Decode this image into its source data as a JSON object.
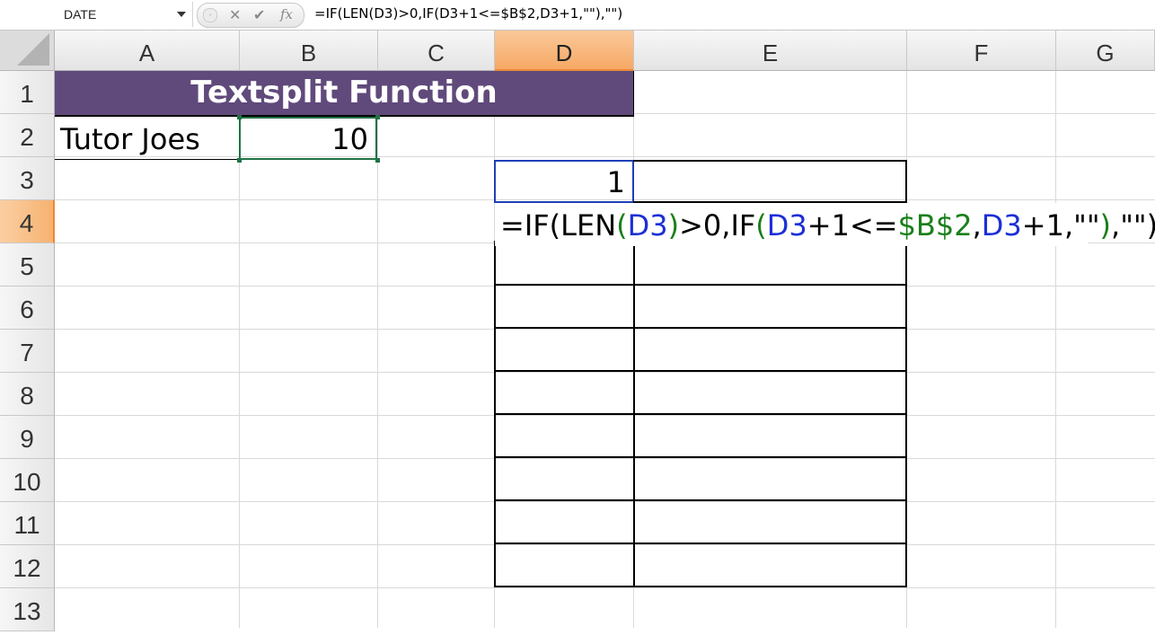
{
  "formula_bar": {
    "name_box": "DATE",
    "handle_glyph": "◦",
    "cancel_glyph": "✕",
    "enter_glyph": "✔",
    "fx_label": "fx",
    "formula": "=IF(LEN(D3)>0,IF(D3+1<=$B$2,D3+1,\"\"),\"\")"
  },
  "columns": [
    {
      "label": "A"
    },
    {
      "label": "B"
    },
    {
      "label": "C"
    },
    {
      "label": "D",
      "selected": true
    },
    {
      "label": "E"
    },
    {
      "label": "F"
    },
    {
      "label": "G"
    }
  ],
  "rows": [
    "1",
    "2",
    "3",
    "4",
    "5",
    "6",
    "7",
    "8",
    "9",
    "10",
    "11",
    "12",
    "13"
  ],
  "selected_row": "4",
  "cells": {
    "title": "Textsplit Function",
    "a2": "Tutor Joes",
    "b2": "10",
    "d3": "1"
  },
  "edit_cell": {
    "address": "D4",
    "tokens": [
      {
        "t": "=IF(LEN",
        "c": ""
      },
      {
        "t": "(",
        "c": "green"
      },
      {
        "t": "D3",
        "c": "blue"
      },
      {
        "t": ")",
        "c": "green"
      },
      {
        "t": ">0,IF",
        "c": ""
      },
      {
        "t": "(",
        "c": "green"
      },
      {
        "t": "D3",
        "c": "blue"
      },
      {
        "t": "+1<=",
        "c": ""
      },
      {
        "t": "$B$2",
        "c": "green"
      },
      {
        "t": ",",
        "c": ""
      },
      {
        "t": "D3",
        "c": "blue"
      },
      {
        "t": "+1,\"\"",
        "c": ""
      },
      {
        "t": ")",
        "c": "green"
      },
      {
        "t": ",\"\")",
        "c": ""
      }
    ]
  },
  "colors": {
    "title_fill": "#604a7b",
    "selected_header": "#f6a965",
    "active_border": "#207245",
    "ref_blue": "#1c2fd6",
    "ref_green": "#1a7f1a"
  }
}
